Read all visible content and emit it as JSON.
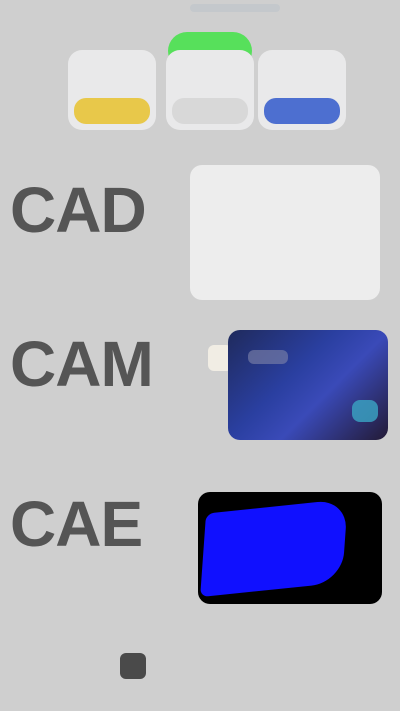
{
  "header": {
    "indicator": ""
  },
  "options": {
    "items": [
      {
        "name": "option-yellow",
        "color": "#e8c84a"
      },
      {
        "name": "option-white",
        "color": "#d8d8d8"
      },
      {
        "name": "option-blue",
        "color": "#4d6fd0"
      }
    ],
    "green_pill_color": "#57e05b"
  },
  "rows": [
    {
      "title": "CAD",
      "subtitle": ""
    },
    {
      "title": "CAM",
      "subtitle": ""
    },
    {
      "title": "CAE",
      "subtitle": ""
    }
  ],
  "footer": {
    "brand_text": ""
  },
  "colors": {
    "background": "#cfcfcf",
    "title_text": "#555555",
    "blue_shape": "#1010ff"
  }
}
